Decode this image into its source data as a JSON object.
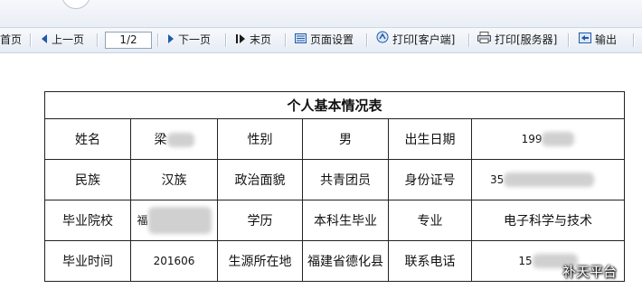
{
  "toolbar": {
    "first_label": "首页",
    "prev_label": "上一页",
    "page_value": "1/2",
    "next_label": "下一页",
    "last_label": "末页",
    "page_setup_label": "页面设置",
    "print_client_label": "打印[客户端]",
    "print_server_label": "打印[服务器]",
    "export_label": "输出"
  },
  "form": {
    "title": "个人基本情况表",
    "rows": [
      [
        "姓名",
        "梁",
        "性别",
        "男",
        "出生日期",
        "199"
      ],
      [
        "民族",
        "汉族",
        "政治面貌",
        "共青团员",
        "身份证号",
        "35"
      ],
      [
        "毕业院校",
        "福",
        "学历",
        "本科生毕业",
        "专业",
        "电子科学与技术"
      ],
      [
        "毕业时间",
        "201606",
        "生源所在地",
        "福建省德化县",
        "联系电话",
        "15"
      ]
    ]
  },
  "watermark": "补天平台",
  "colors": {
    "toolbar_icon": "#1f5aa8",
    "border": "#222222"
  }
}
